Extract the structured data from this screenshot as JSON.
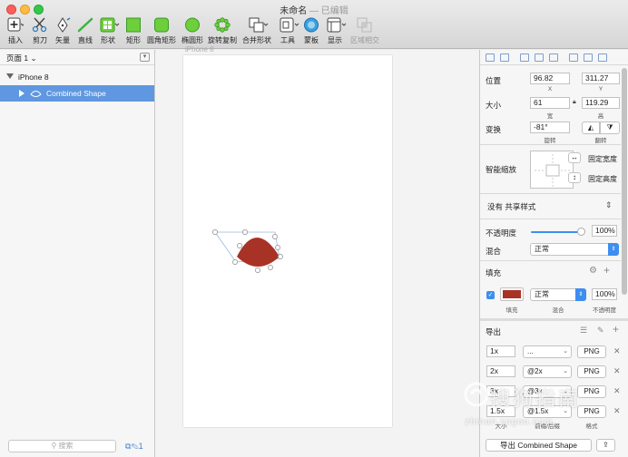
{
  "window": {
    "title": "未命名",
    "status": "— 已编辑"
  },
  "toolbar": {
    "items": [
      {
        "label": "插入",
        "icon": "plus-icon"
      },
      {
        "label": "剪刀",
        "icon": "scissors-icon"
      },
      {
        "label": "矢量",
        "icon": "pen-icon"
      },
      {
        "label": "直线",
        "icon": "line-icon"
      },
      {
        "label": "形状",
        "icon": "shapes-icon"
      },
      {
        "label": "矩形",
        "icon": "rectangle-icon"
      },
      {
        "label": "圆角矩形",
        "icon": "rounded-rectangle-icon"
      },
      {
        "label": "椭圆形",
        "icon": "oval-icon"
      },
      {
        "label": "旋转复制",
        "icon": "rotate-copies-icon"
      },
      {
        "label": "合并形状",
        "icon": "combine-shapes-icon"
      },
      {
        "label": "工具",
        "icon": "tools-icon"
      },
      {
        "label": "蒙板",
        "icon": "mask-icon"
      },
      {
        "label": "显示",
        "icon": "view-icon"
      },
      {
        "label": "区域相交",
        "icon": "intersect-icon"
      }
    ]
  },
  "sidebar": {
    "page_selector": "页面 1",
    "artboard": "iPhone 8",
    "layer": "Combined Shape",
    "search_placeholder": "搜索",
    "tools_count": "1"
  },
  "canvas": {
    "artboard_label": "iPhone 8"
  },
  "inspector": {
    "position_label": "位置",
    "x": "96.82",
    "y": "311.27",
    "x_label": "X",
    "y_label": "Y",
    "size_label": "大小",
    "width": "61",
    "height": "119.29",
    "w_label": "宽",
    "h_label": "高",
    "transform_label": "变换",
    "rotation": "-81°",
    "rotate_label": "旋转",
    "flip_label": "翻转",
    "resizing_label": "智能缩放",
    "fix_width": "固定宽度",
    "fix_height": "固定高度",
    "shared_style": "没有 共享样式",
    "opacity_label": "不透明度",
    "opacity": "100%",
    "blend_label": "混合",
    "blend": "正常",
    "fills_title": "填充",
    "fill_color": "#a93226",
    "fill_blend": "正常",
    "fill_opacity": "100%",
    "fill_sub": "填充",
    "blend_sub": "混合",
    "opacity_sub": "不透明度",
    "export_title": "导出",
    "exports": [
      {
        "size": "1x",
        "suffix": "...",
        "format": "PNG"
      },
      {
        "size": "2x",
        "suffix": "@2x",
        "format": "PNG"
      },
      {
        "size": "3x",
        "suffix": "@3x",
        "format": "PNG"
      },
      {
        "size": "1.5x",
        "suffix": "@1.5x",
        "format": "PNG"
      }
    ],
    "export_sub_size": "大小",
    "export_sub_suffix": "前缀/后缀",
    "export_sub_format": "格式",
    "export_button": "导出 Combined Shape"
  },
  "watermark": {
    "brand": "搜狗指南",
    "url": "zhinan.sogou.com"
  },
  "colors": {
    "selection": "#5f97e0",
    "accent": "#3d8ef0",
    "shape": "#a93226"
  }
}
